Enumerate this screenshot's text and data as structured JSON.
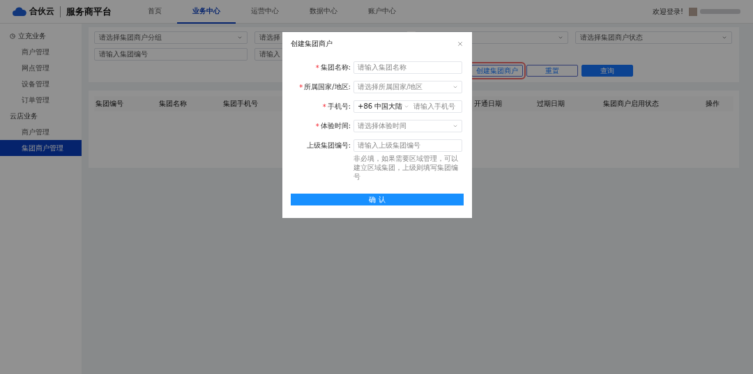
{
  "header": {
    "logo": "合伙云",
    "platform": "服务商平台",
    "nav": [
      {
        "label": "首页",
        "selected": false
      },
      {
        "label": "业务中心",
        "selected": true
      },
      {
        "label": "运营中心",
        "selected": false
      },
      {
        "label": "数据中心",
        "selected": false
      },
      {
        "label": "账户中心",
        "selected": false
      }
    ],
    "welcome": "欢迎登录!"
  },
  "sidebar": {
    "groups": [
      {
        "title": "立充业务",
        "items": [
          {
            "label": "商户管理",
            "selected": false
          },
          {
            "label": "网点管理",
            "selected": false
          },
          {
            "label": "设备管理",
            "selected": false
          },
          {
            "label": "订单管理",
            "selected": false
          }
        ]
      },
      {
        "title": "云店业务",
        "items": [
          {
            "label": "商户管理",
            "selected": false
          },
          {
            "label": "集团商户管理",
            "selected": true
          }
        ]
      }
    ]
  },
  "filters": [
    {
      "kind": "select",
      "placeholder": "请选择集团商户分组"
    },
    {
      "kind": "input",
      "placeholder": "请选择"
    },
    {
      "kind": "select"
    },
    {
      "kind": "select",
      "placeholder": "请选择集团商户状态"
    },
    {
      "kind": "input",
      "placeholder": "请输入集团编号"
    },
    {
      "kind": "input",
      "placeholder": "请输入"
    }
  ],
  "actions": [
    {
      "label": "创建集团商户",
      "kind": "highlighted"
    },
    {
      "label": "重置",
      "kind": "outline"
    },
    {
      "label": "查询",
      "kind": "primary"
    }
  ],
  "table": {
    "columns": [
      "集团编号",
      "集团名称",
      "集团手机号",
      "",
      "开通日期",
      "过期日期",
      "集团商户启用状态",
      "操作"
    ]
  },
  "dialog": {
    "title": "创建集团商户",
    "fields": [
      {
        "mark": "*",
        "label": "集团名称:",
        "kind": "input",
        "placeholder": "请输入集团名称"
      },
      {
        "mark": "*",
        "label": "所属国家/地区:",
        "kind": "select",
        "placeholder": "请选择所属国家/地区"
      },
      {
        "mark": "*",
        "label": "手机号:",
        "kind": "phone",
        "prefix": "+86 中国大陆",
        "placeholder": "请输入手机号"
      },
      {
        "mark": "*",
        "label": "体验时间:",
        "kind": "select",
        "placeholder": "请选择体验时间"
      },
      {
        "label": "上级集团编号:",
        "kind": "input",
        "placeholder": "请输入上级集团编号",
        "hint": "非必填，如果需要区域管理，可以建立区域集团，上级则填写集团编号"
      }
    ],
    "confirm": "确 认"
  }
}
